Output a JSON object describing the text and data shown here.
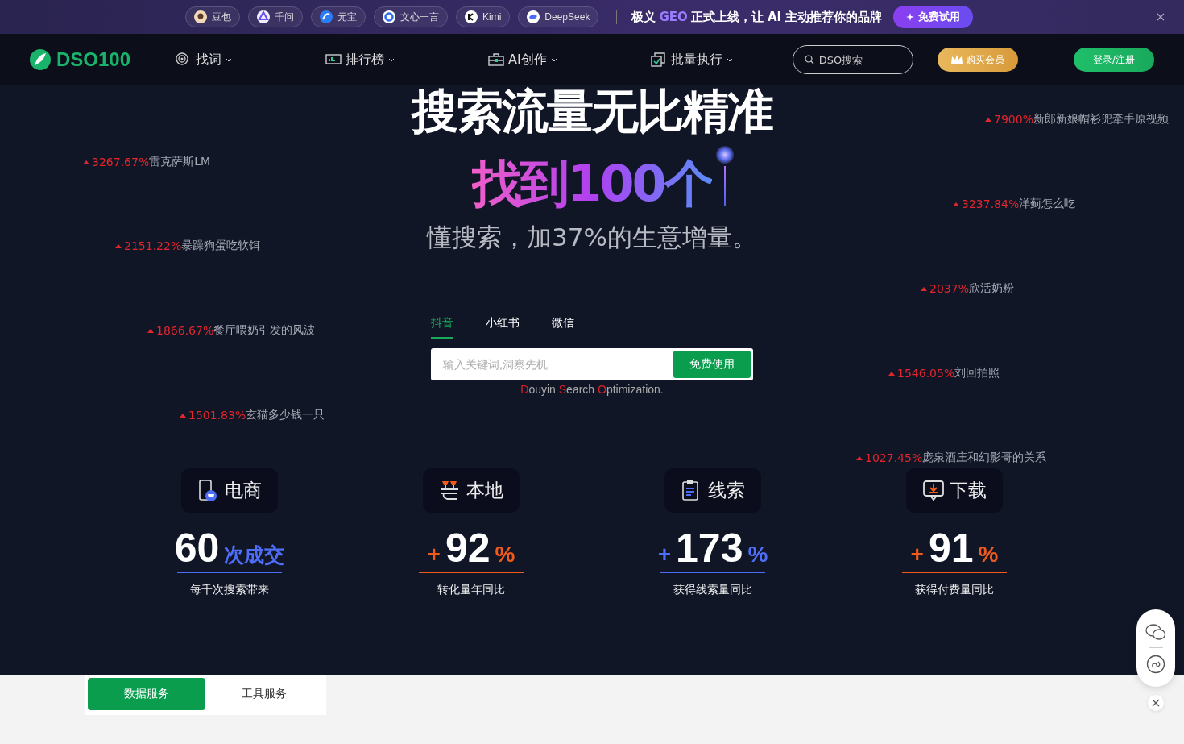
{
  "top_banner": {
    "ai_chips": [
      {
        "label": "豆包"
      },
      {
        "label": "千问"
      },
      {
        "label": "元宝"
      },
      {
        "label": "文心一言"
      },
      {
        "label": "Kimi"
      },
      {
        "label": "DeepSeek"
      }
    ],
    "promo": {
      "before": "极义",
      "highlight": "GEO",
      "after": "正式上线，让 AI 主动推荐你的品牌"
    },
    "cta": "免费试用"
  },
  "nav": {
    "logo": "DSO100",
    "menu": [
      {
        "label": "找词"
      },
      {
        "label": "排行榜"
      },
      {
        "label": "AI创作"
      },
      {
        "label": "批量执行"
      }
    ],
    "search_placeholder": "DSO搜索",
    "member_button": "购买会员",
    "login_button": "登录/注册"
  },
  "hero": {
    "title": "搜索流量无比精准",
    "highlight": "找到100个",
    "subtitle": "懂搜索，加37%的生意增量。",
    "platform_tabs": [
      {
        "label": "抖音",
        "selected": true
      },
      {
        "label": "小红书",
        "selected": false
      },
      {
        "label": "微信",
        "selected": false
      }
    ],
    "search_placeholder": "输入关键词,洞察先机",
    "search_button": "免费使用",
    "tagline": [
      {
        "text": "D",
        "accent": true
      },
      {
        "text": "ouyin ",
        "accent": false
      },
      {
        "text": "S",
        "accent": true
      },
      {
        "text": "earch ",
        "accent": false
      },
      {
        "text": "O",
        "accent": true
      },
      {
        "text": "ptimization.",
        "accent": false
      }
    ],
    "trending": [
      {
        "growth": "7900%",
        "keyword": "新郎新娘帽衫兜牵手原视频"
      },
      {
        "growth": "3267.67%",
        "keyword": "雷克萨斯LM"
      },
      {
        "growth": "3237.84%",
        "keyword": "洋蓟怎么吃"
      },
      {
        "growth": "2151.22%",
        "keyword": "暴躁狗蛋吃软饵"
      },
      {
        "growth": "2037%",
        "keyword": "欣活奶粉"
      },
      {
        "growth": "1866.67%",
        "keyword": "餐厅喂奶引发的风波"
      },
      {
        "growth": "1546.05%",
        "keyword": "刘回拍照"
      },
      {
        "growth": "1501.83%",
        "keyword": "玄猫多少钱一只"
      },
      {
        "growth": "1027.45%",
        "keyword": "庞泉酒庄和幻影哥的关系"
      }
    ]
  },
  "stats": [
    {
      "kind": "shop",
      "label": "电商",
      "value": "60",
      "suffix": "次成交",
      "color": "#4f6ef7",
      "caption": "每千次搜索带来"
    },
    {
      "kind": "local",
      "label": "本地",
      "prefix": "+",
      "value": "92",
      "suffix": "%",
      "color": "#f05a1a",
      "caption": "转化量年同比"
    },
    {
      "kind": "lead",
      "label": "线索",
      "prefix": "+",
      "value": "173",
      "suffix": "%",
      "color": "#4f6ef7",
      "caption": "获得线索量同比"
    },
    {
      "kind": "download",
      "label": "下载",
      "prefix": "+",
      "value": "91",
      "suffix": "%",
      "color": "#f05a1a",
      "caption": "获得付费量同比"
    }
  ],
  "service_tabs": [
    {
      "label": "数据服务",
      "selected": true
    },
    {
      "label": "工具服务",
      "selected": false
    }
  ]
}
